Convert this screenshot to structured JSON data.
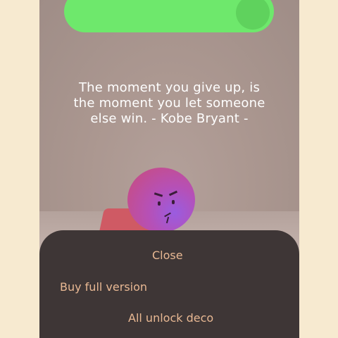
{
  "top_toggle": {
    "state": "on",
    "color": "#6ee86c"
  },
  "quote": {
    "line1": "The moment you give up, is",
    "line2": "the moment you let someone",
    "line3": "else win. - Kobe Bryant -"
  },
  "menu": {
    "close_label": "Close",
    "buy_label": "Buy full version",
    "deco_label": "All unlock deco"
  },
  "colors": {
    "background": "#f7ead0",
    "sheet": "#3e3636",
    "menu_text": "#e8b893",
    "quote_text": "#ffffff"
  }
}
